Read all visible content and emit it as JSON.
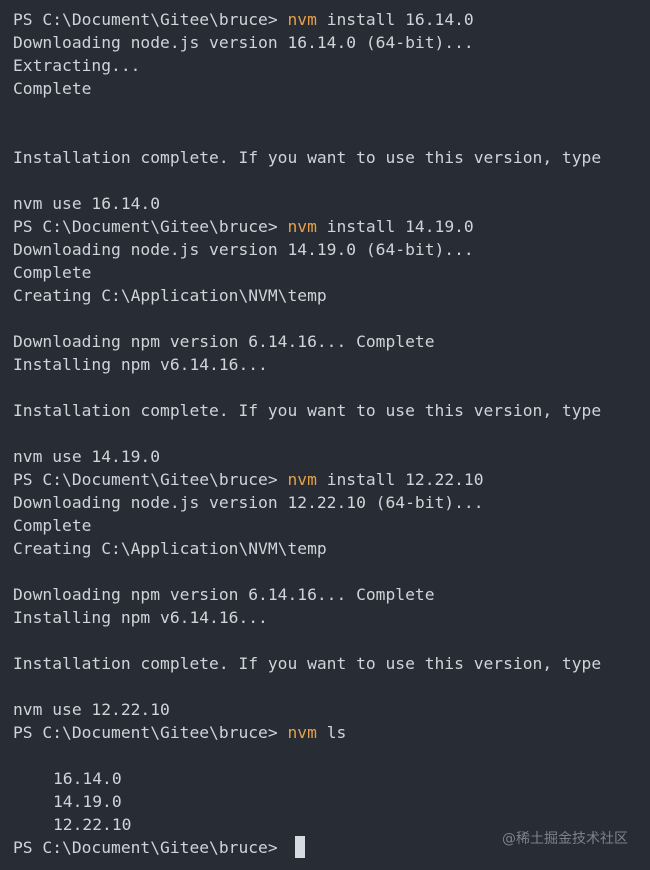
{
  "terminal": {
    "prompt": "PS C:\\Document\\Gitee\\bruce> ",
    "blocks": {
      "b1": {
        "cmd": "nvm",
        "args": " install 16.14.0",
        "out1": "Downloading node.js version 16.14.0 (64-bit)...",
        "out2": "Extracting...",
        "out3": "Complete",
        "out4": "Installation complete. If you want to use this version, type",
        "out5": "nvm use 16.14.0"
      },
      "b2": {
        "cmd": "nvm",
        "args": " install 14.19.0",
        "out1": "Downloading node.js version 14.19.0 (64-bit)...",
        "out2": "Complete",
        "out3": "Creating C:\\Application\\NVM\\temp",
        "out4": "Downloading npm version 6.14.16... Complete",
        "out5": "Installing npm v6.14.16...",
        "out6": "Installation complete. If you want to use this version, type",
        "out7": "nvm use 14.19.0"
      },
      "b3": {
        "cmd": "nvm",
        "args": " install 12.22.10",
        "out1": "Downloading node.js version 12.22.10 (64-bit)...",
        "out2": "Complete",
        "out3": "Creating C:\\Application\\NVM\\temp",
        "out4": "Downloading npm version 6.14.16... Complete",
        "out5": "Installing npm v6.14.16...",
        "out6": "Installation complete. If you want to use this version, type",
        "out7": "nvm use 12.22.10"
      },
      "b4": {
        "cmd": "nvm",
        "args": " ls",
        "versions": [
          "16.14.0",
          "14.19.0",
          "12.22.10"
        ]
      }
    }
  },
  "watermark": "@稀土掘金技术社区",
  "colors": {
    "background": "#282c34",
    "text": "#cfd3da",
    "command": "#e5a04a",
    "cursor": "#d7dae0"
  }
}
